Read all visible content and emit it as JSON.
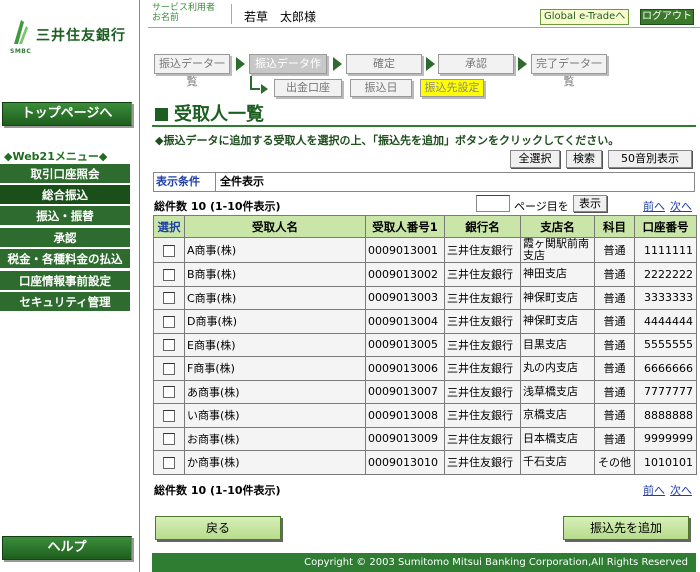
{
  "brand": {
    "bank_name": "三井住友銀行",
    "logo_text": "SMBC",
    "accent": "#2e7d32"
  },
  "sidebar": {
    "top_page": "トップページへ",
    "menu_title": "◆Web21メニュー◆",
    "items": [
      {
        "label": "取引口座照会"
      },
      {
        "label": "総合振込"
      },
      {
        "label": "振込・振替"
      },
      {
        "label": "承認"
      },
      {
        "label": "税金・各種料金の払込"
      },
      {
        "label": "口座情報事前設定"
      },
      {
        "label": "セキュリティ管理"
      }
    ],
    "help": "ヘルプ"
  },
  "header": {
    "service_user_label_1": "サービス利用者",
    "service_user_label_2": "お名前",
    "user_name": "若草　太郎様",
    "global_link": "Global e-Tradeへ",
    "logout": "ログアウト"
  },
  "steps": [
    {
      "label": "振込データ一覧"
    },
    {
      "label": "振込データ作成"
    },
    {
      "label": "確定"
    },
    {
      "label": "承認"
    },
    {
      "label": "完了データ一覧"
    }
  ],
  "substeps": [
    {
      "label": "出金口座"
    },
    {
      "label": "振込日"
    },
    {
      "label": "振込先設定"
    }
  ],
  "page": {
    "title": "受取人一覧",
    "instruction": "◆振込データに追加する受取人を選択の上、「振込先を追加」ボタンをクリックしてください。",
    "select_all": "全選択",
    "search": "検索",
    "kana_index": "50音別表示",
    "condition_label": "表示条件",
    "condition_value": "全件表示",
    "total": "総件数 10 (1-10件表示)",
    "page_suffix": "ページ目を",
    "show": "表示",
    "prev": "前へ",
    "next": "次へ",
    "back": "戻る",
    "add": "振込先を追加"
  },
  "table": {
    "headers": [
      "選択",
      "受取人名",
      "受取人番号1",
      "銀行名",
      "支店名",
      "科目",
      "口座番号"
    ],
    "rows": [
      {
        "name": "A商事(株)",
        "number": "0009013001",
        "bank": "三井住友銀行",
        "branch": "霞ヶ関駅前南支店",
        "type": "普通",
        "account": "1111111"
      },
      {
        "name": "B商事(株)",
        "number": "0009013002",
        "bank": "三井住友銀行",
        "branch": "神田支店",
        "type": "普通",
        "account": "2222222"
      },
      {
        "name": "C商事(株)",
        "number": "0009013003",
        "bank": "三井住友銀行",
        "branch": "神保町支店",
        "type": "普通",
        "account": "3333333"
      },
      {
        "name": "D商事(株)",
        "number": "0009013004",
        "bank": "三井住友銀行",
        "branch": "神保町支店",
        "type": "普通",
        "account": "4444444"
      },
      {
        "name": "E商事(株)",
        "number": "0009013005",
        "bank": "三井住友銀行",
        "branch": "目黒支店",
        "type": "普通",
        "account": "5555555"
      },
      {
        "name": "F商事(株)",
        "number": "0009013006",
        "bank": "三井住友銀行",
        "branch": "丸の内支店",
        "type": "普通",
        "account": "6666666"
      },
      {
        "name": "あ商事(株)",
        "number": "0009013007",
        "bank": "三井住友銀行",
        "branch": "浅草橋支店",
        "type": "普通",
        "account": "7777777"
      },
      {
        "name": "い商事(株)",
        "number": "0009013008",
        "bank": "三井住友銀行",
        "branch": "京橋支店",
        "type": "普通",
        "account": "8888888"
      },
      {
        "name": "お商事(株)",
        "number": "0009013009",
        "bank": "三井住友銀行",
        "branch": "日本橋支店",
        "type": "普通",
        "account": "9999999"
      },
      {
        "name": "か商事(株)",
        "number": "0009013010",
        "bank": "三井住友銀行",
        "branch": "千石支店",
        "type": "その他",
        "account": "1010101"
      }
    ]
  },
  "footer": {
    "copyright": "Copyright © 2003 Sumitomo Mitsui Banking Corporation,All Rights Reserved"
  }
}
